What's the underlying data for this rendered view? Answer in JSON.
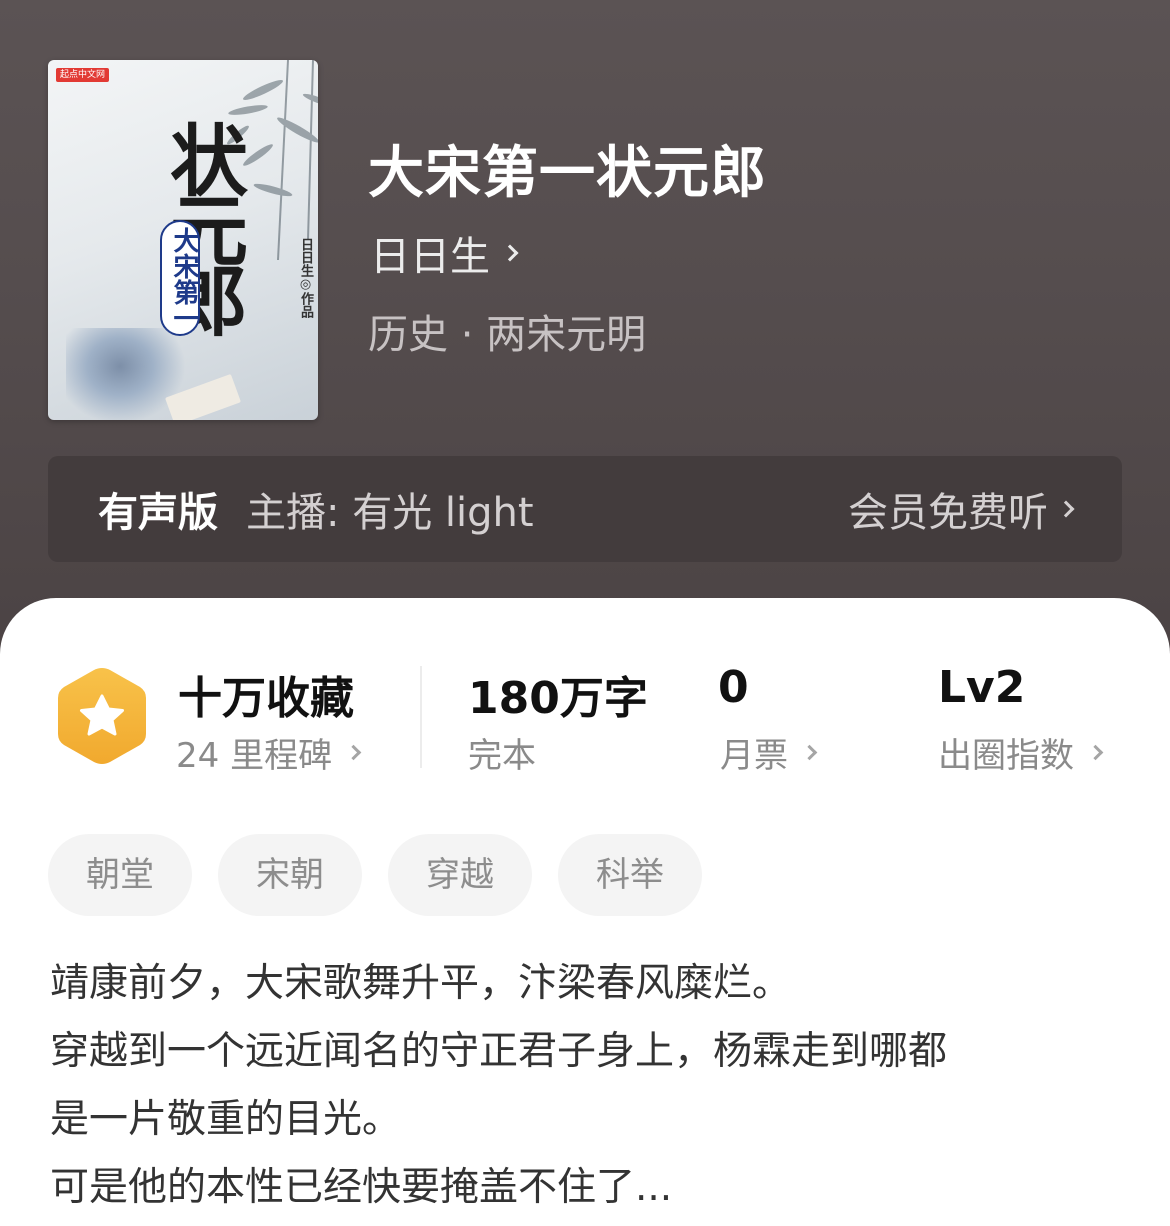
{
  "book": {
    "title": "大宋第一状元郎",
    "author": "日日生",
    "genre": "历史 · 两宋元明"
  },
  "cover": {
    "title_big": "状元郎",
    "seal_text": "大宋第一",
    "author_credit": "日日生◎作品",
    "logo": "起点中文网"
  },
  "audio": {
    "label": "有声版",
    "host": "主播: 有光 light",
    "link": "会员免费听"
  },
  "stats": {
    "collect": {
      "main": "十万收藏",
      "sub": "24 里程碑"
    },
    "words": {
      "main": "180万字",
      "sub": "完本"
    },
    "votes": {
      "main": "0",
      "sub": "月票"
    },
    "level": {
      "main": "Lv2",
      "sub": "出圈指数"
    }
  },
  "tags": [
    "朝堂",
    "宋朝",
    "穿越",
    "科举"
  ],
  "synopsis": [
    "靖康前夕，大宋歌舞升平，汴梁春风糜烂。",
    "穿越到一个远近闻名的守正君子身上，杨霖走到哪都",
    "是一片敬重的目光。",
    "可是他的本性已经快要掩盖不住了..."
  ],
  "colors": {
    "header_bg": "#5b5354",
    "audio_bar": "#433c3d",
    "badge": "#f5b73b",
    "tag_bg": "#f4f4f4"
  },
  "icons": [
    "star-badge-icon",
    "chevron-right-icon"
  ]
}
